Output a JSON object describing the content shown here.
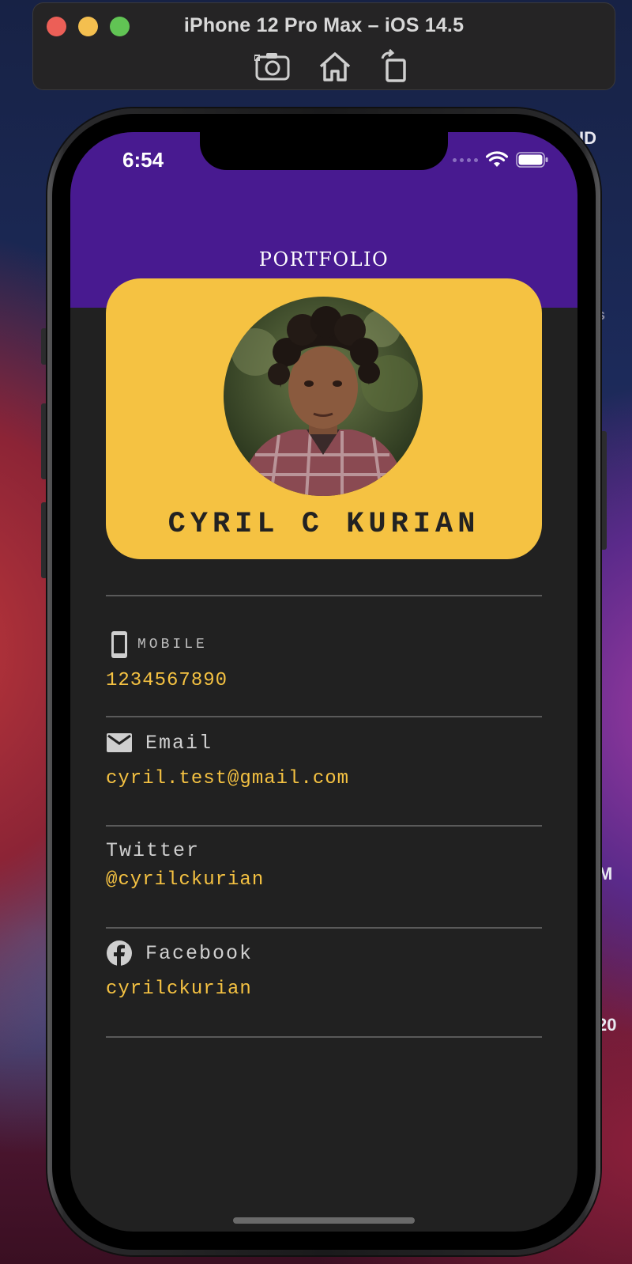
{
  "simulator": {
    "title": "iPhone 12 Pro Max – iOS 14.5",
    "tools": [
      "screenshot-icon",
      "home-icon",
      "rotate-icon"
    ]
  },
  "desktop": {
    "edge_labels": [
      "ID",
      "s",
      "M",
      "20"
    ]
  },
  "status_bar": {
    "time": "6:54",
    "icons": [
      "cellular-dots-icon",
      "wifi-icon",
      "battery-icon"
    ]
  },
  "app_bar": {
    "title": "PORTFOLIO"
  },
  "profile": {
    "name": "CYRIL C KURIAN",
    "avatar": "profile-photo"
  },
  "contacts": [
    {
      "icon": "mobile-phone-icon",
      "label": "MOBILE",
      "value": "1234567890"
    },
    {
      "icon": "email-icon",
      "label": "Email",
      "value": "cyril.test@gmail.com"
    },
    {
      "icon": "",
      "label": "Twitter",
      "value": "@cyrilckurian"
    },
    {
      "icon": "facebook-icon",
      "label": "Facebook",
      "value": "cyrilckurian"
    }
  ],
  "colors": {
    "app_bar": "#481a90",
    "background": "#212121",
    "card": "#f5c242",
    "accent_text": "#f5c242"
  }
}
